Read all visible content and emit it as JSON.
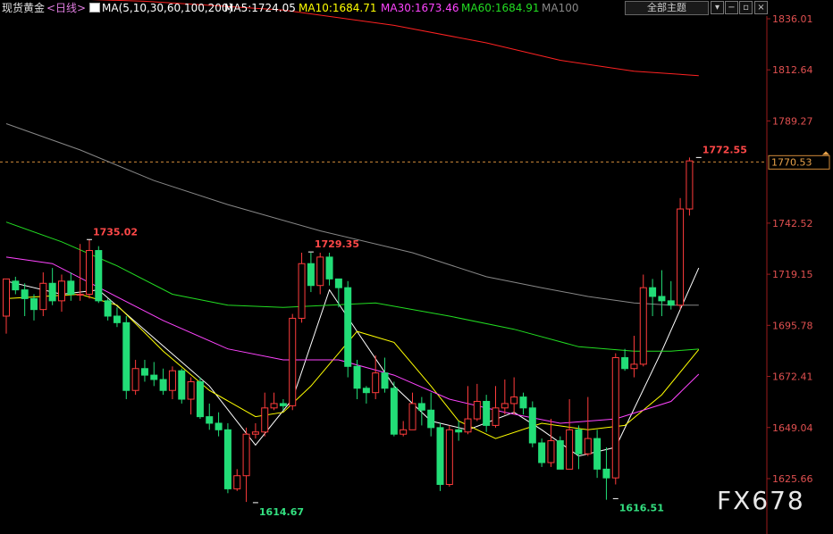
{
  "header": {
    "instrument": "现货黄金",
    "period": "<日线>",
    "ma_title": "MA(5,10,30,60,100,200)",
    "ma5": "MA5:1724.05",
    "ma10": "MA10:1684.71",
    "ma30": "MA30:1673.46",
    "ma60": "MA60:1684.91",
    "ma100": "MA100",
    "theme_select": "全部主题",
    "colors": {
      "instrument": "#e0e0e0",
      "period": "#e07de0",
      "ma5": "#ffffff",
      "ma10": "#ffff00",
      "ma30": "#ff44ff",
      "ma60": "#22dd22",
      "ma100": "#888888"
    }
  },
  "toolbar_icons": [
    "dropdown-arrow-icon",
    "minus-icon",
    "window-icon",
    "close-icon"
  ],
  "watermark": "FX678",
  "chart_data": {
    "type": "candlestick",
    "y_ticks": [
      1836.01,
      1812.64,
      1789.27,
      1742.52,
      1719.15,
      1695.78,
      1672.41,
      1649.04,
      1625.66
    ],
    "ylim": [
      1614.0,
      1846.0
    ],
    "current_price": 1770.53,
    "annotations": [
      {
        "text": "1735.02",
        "index": 9,
        "value": 1735.02,
        "type": "high"
      },
      {
        "text": "1614.67",
        "index": 27,
        "value": 1614.67,
        "type": "low"
      },
      {
        "text": "1729.35",
        "index": 33,
        "value": 1729.35,
        "type": "high"
      },
      {
        "text": "1616.51",
        "index": 66,
        "value": 1616.51,
        "type": "low"
      },
      {
        "text": "1772.55",
        "index": 75,
        "value": 1772.55,
        "type": "high"
      }
    ],
    "candles": [
      [
        1700,
        1717,
        1716,
        1692
      ],
      [
        1716,
        1712,
        1718,
        1710
      ],
      [
        1712,
        1708,
        1715,
        1700
      ],
      [
        1708,
        1703,
        1710,
        1698
      ],
      [
        1703,
        1715,
        1720,
        1700
      ],
      [
        1715,
        1707,
        1722,
        1705
      ],
      [
        1707,
        1716,
        1719,
        1702
      ],
      [
        1716,
        1710,
        1720,
        1707
      ],
      [
        1710,
        1710,
        1733,
        1707
      ],
      [
        1710,
        1730,
        1735,
        1708
      ],
      [
        1730,
        1707,
        1732,
        1706
      ],
      [
        1707,
        1700,
        1708,
        1698
      ],
      [
        1700,
        1697,
        1704,
        1695
      ],
      [
        1697,
        1666,
        1700,
        1662
      ],
      [
        1666,
        1676,
        1680,
        1664
      ],
      [
        1676,
        1673,
        1680,
        1670
      ],
      [
        1673,
        1671,
        1679,
        1668
      ],
      [
        1671,
        1666,
        1676,
        1664
      ],
      [
        1666,
        1675,
        1677,
        1662
      ],
      [
        1675,
        1662,
        1676,
        1660
      ],
      [
        1662,
        1670,
        1672,
        1655
      ],
      [
        1670,
        1654,
        1672,
        1653
      ],
      [
        1654,
        1651,
        1660,
        1648
      ],
      [
        1651,
        1648,
        1656,
        1645
      ],
      [
        1648,
        1621,
        1651,
        1619
      ],
      [
        1621,
        1627,
        1630,
        1620
      ],
      [
        1627,
        1646,
        1649,
        1615
      ],
      [
        1646,
        1647,
        1651,
        1644
      ],
      [
        1647,
        1658,
        1665,
        1645
      ],
      [
        1658,
        1660,
        1665,
        1657
      ],
      [
        1660,
        1659,
        1662,
        1657
      ],
      [
        1659,
        1699,
        1701,
        1657
      ],
      [
        1699,
        1724,
        1729,
        1697
      ],
      [
        1724,
        1714,
        1729,
        1711
      ],
      [
        1714,
        1727,
        1729,
        1710
      ],
      [
        1727,
        1717,
        1729,
        1714
      ],
      [
        1717,
        1713,
        1716,
        1704
      ],
      [
        1713,
        1677,
        1716,
        1672
      ],
      [
        1677,
        1667,
        1680,
        1662
      ],
      [
        1667,
        1665,
        1668,
        1660
      ],
      [
        1665,
        1674,
        1682,
        1662
      ],
      [
        1674,
        1667,
        1681,
        1665
      ],
      [
        1667,
        1646,
        1670,
        1645
      ],
      [
        1646,
        1648,
        1652,
        1645
      ],
      [
        1648,
        1660,
        1665,
        1655
      ],
      [
        1660,
        1657,
        1663,
        1650
      ],
      [
        1657,
        1649,
        1665,
        1645
      ],
      [
        1649,
        1623,
        1651,
        1620
      ],
      [
        1623,
        1648,
        1650,
        1622
      ],
      [
        1648,
        1647,
        1652,
        1643
      ],
      [
        1647,
        1653,
        1668,
        1646
      ],
      [
        1653,
        1661,
        1669,
        1652
      ],
      [
        1661,
        1650,
        1664,
        1647
      ],
      [
        1650,
        1658,
        1668,
        1649
      ],
      [
        1658,
        1660,
        1671,
        1655
      ],
      [
        1660,
        1663,
        1672,
        1655
      ],
      [
        1663,
        1658,
        1665,
        1655
      ],
      [
        1658,
        1642,
        1661,
        1640
      ],
      [
        1642,
        1633,
        1644,
        1631
      ],
      [
        1633,
        1643,
        1653,
        1631
      ],
      [
        1643,
        1630,
        1645,
        1630
      ],
      [
        1630,
        1648,
        1662,
        1632
      ],
      [
        1648,
        1637,
        1650,
        1630
      ],
      [
        1637,
        1644,
        1663,
        1636
      ],
      [
        1644,
        1630,
        1648,
        1626
      ],
      [
        1630,
        1626,
        1640,
        1616
      ],
      [
        1626,
        1681,
        1683,
        1623
      ],
      [
        1681,
        1676,
        1685,
        1675
      ],
      [
        1676,
        1678,
        1691,
        1672
      ],
      [
        1678,
        1713,
        1719,
        1677
      ],
      [
        1713,
        1709,
        1717,
        1700
      ],
      [
        1709,
        1707,
        1721,
        1700
      ],
      [
        1707,
        1705,
        1716,
        1703
      ],
      [
        1705,
        1749,
        1754,
        1703
      ],
      [
        1749,
        1771,
        1772.55,
        1746
      ]
    ],
    "ma_lines": [
      {
        "name": "MA5",
        "color": "#ffffff",
        "points": [
          [
            0,
            1716
          ],
          [
            6,
            1710
          ],
          [
            10,
            1712
          ],
          [
            16,
            1690
          ],
          [
            22,
            1668
          ],
          [
            27,
            1641
          ],
          [
            31,
            1662
          ],
          [
            35,
            1712
          ],
          [
            38,
            1693
          ],
          [
            42,
            1668
          ],
          [
            46,
            1652
          ],
          [
            50,
            1648
          ],
          [
            55,
            1656
          ],
          [
            58,
            1648
          ],
          [
            62,
            1636
          ],
          [
            66,
            1640
          ],
          [
            71,
            1684
          ],
          [
            75,
            1722
          ]
        ]
      },
      {
        "name": "MA10",
        "color": "#ffff00",
        "points": [
          [
            0,
            1708
          ],
          [
            8,
            1710
          ],
          [
            12,
            1705
          ],
          [
            17,
            1684
          ],
          [
            22,
            1666
          ],
          [
            27,
            1654
          ],
          [
            30,
            1656
          ],
          [
            33,
            1668
          ],
          [
            38,
            1693
          ],
          [
            42,
            1688
          ],
          [
            46,
            1668
          ],
          [
            49,
            1652
          ],
          [
            53,
            1644
          ],
          [
            58,
            1651
          ],
          [
            63,
            1648
          ],
          [
            67,
            1650
          ],
          [
            71,
            1664
          ],
          [
            75,
            1684.71
          ]
        ]
      },
      {
        "name": "MA30",
        "color": "#ff44ff",
        "points": [
          [
            0,
            1727
          ],
          [
            5,
            1724
          ],
          [
            11,
            1711
          ],
          [
            17,
            1698
          ],
          [
            24,
            1685
          ],
          [
            30,
            1680
          ],
          [
            36,
            1680
          ],
          [
            42,
            1673
          ],
          [
            48,
            1662
          ],
          [
            54,
            1656
          ],
          [
            60,
            1651
          ],
          [
            66,
            1653
          ],
          [
            72,
            1661
          ],
          [
            75,
            1673.46
          ]
        ]
      },
      {
        "name": "MA60",
        "color": "#22dd22",
        "points": [
          [
            0,
            1743
          ],
          [
            6,
            1734
          ],
          [
            12,
            1723
          ],
          [
            18,
            1710
          ],
          [
            24,
            1705
          ],
          [
            30,
            1704
          ],
          [
            40,
            1706
          ],
          [
            48,
            1700
          ],
          [
            55,
            1694
          ],
          [
            62,
            1686
          ],
          [
            68,
            1684
          ],
          [
            72,
            1684
          ],
          [
            75,
            1684.91
          ]
        ]
      },
      {
        "name": "MA100",
        "color": "#888888",
        "points": [
          [
            0,
            1788
          ],
          [
            8,
            1776
          ],
          [
            16,
            1762
          ],
          [
            24,
            1751
          ],
          [
            34,
            1739
          ],
          [
            44,
            1729
          ],
          [
            52,
            1718
          ],
          [
            58,
            1713
          ],
          [
            63,
            1709
          ],
          [
            68,
            1706
          ],
          [
            72,
            1705
          ],
          [
            75,
            1705
          ]
        ]
      },
      {
        "name": "MA200",
        "color": "#ff2222",
        "points": [
          [
            0,
            1846
          ],
          [
            15,
            1844
          ],
          [
            30,
            1840
          ],
          [
            42,
            1833
          ],
          [
            52,
            1825
          ],
          [
            60,
            1817
          ],
          [
            68,
            1812
          ],
          [
            75,
            1810
          ]
        ]
      }
    ]
  }
}
